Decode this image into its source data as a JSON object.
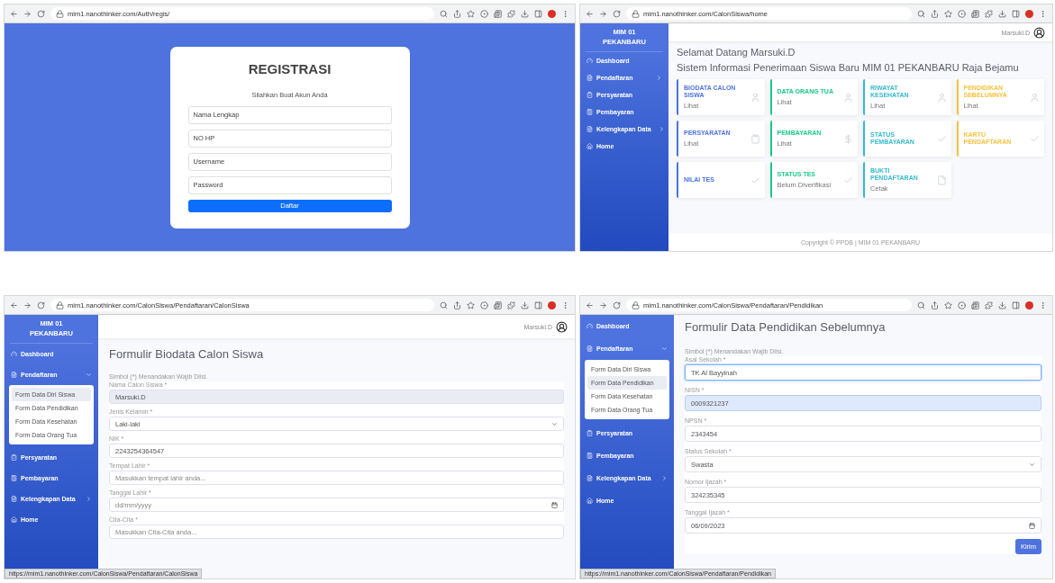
{
  "screens": [
    {
      "kind": "register",
      "url": "mim1.nanothinker.com/Auth/regis/",
      "title": "REGISTRASI",
      "subtitle": "Silahkan Buat Akun Anda",
      "fields": [
        {
          "placeholder": "Nama Lengkap"
        },
        {
          "placeholder": "NO HP"
        },
        {
          "placeholder": "Username"
        },
        {
          "placeholder": "Password"
        }
      ],
      "submit": "Daftar"
    },
    {
      "kind": "dashboard",
      "url": "mim1.nanothinker.com/CalonSiswa/home",
      "brand": "MIM 01 PEKANBARU",
      "user": "Marsuki.D",
      "menu": [
        {
          "kind": "link",
          "label": "Dashboard"
        },
        {
          "kind": "group",
          "label": "Pendaftaran",
          "expanded": false
        },
        {
          "kind": "link",
          "label": "Persyaratan"
        },
        {
          "kind": "link",
          "label": "Pembayaran"
        },
        {
          "kind": "group",
          "label": "Kelengkapan Data",
          "expanded": false
        },
        {
          "kind": "link",
          "label": "Home"
        }
      ],
      "welcome": "Selamat Datang Marsuki.D",
      "headline": "Sistem Informasi Penerimaan Siswa Baru MIM 01 PEKANBARU Raja Bejamu",
      "cards": [
        {
          "title": "BIODATA CALON SISWA",
          "value": "Lihat",
          "color": "#4e73df",
          "kind": "user"
        },
        {
          "title": "DATA ORANG TUA",
          "value": "Lihat",
          "color": "#1cc88a",
          "kind": "user"
        },
        {
          "title": "RIWAYAT KESEHATAN",
          "value": "Lihat",
          "color": "#36b9cc",
          "kind": "user"
        },
        {
          "title": "PENDIDIKAN SEBELUMNYA",
          "value": "Lihat",
          "color": "#f6c23e",
          "kind": "user"
        },
        {
          "title": "PERSYARATAN",
          "value": "Lihat",
          "color": "#4e73df",
          "kind": "clipboard"
        },
        {
          "title": "PEMBAYARAN",
          "value": "Lihat",
          "color": "#1cc88a",
          "kind": "dollar"
        },
        {
          "title": "STATUS PEMBAYARAN",
          "color": "#36b9cc",
          "kind": "check"
        },
        {
          "title": "KARTU PENDAFTARAN",
          "color": "#f6c23e",
          "kind": "check"
        },
        {
          "title": "NILAI TES",
          "color": "#4e73df",
          "kind": "check"
        },
        {
          "title": "STATUS TES",
          "value": "Belum Diverifikasi",
          "color": "#1cc88a",
          "kind": "check"
        },
        {
          "title": "BUKTI PENDAFTARAN",
          "value": "Cetak",
          "color": "#36b9cc",
          "kind": "file"
        }
      ],
      "footer": "Copyright © PPDB | MIM 01 PEKANBARU"
    },
    {
      "kind": "form",
      "url": "mim1.nanothinker.com/CalonSiswa/Pendaftaran/CalonSiswa",
      "brand": "MIM 01 PEKANBARU",
      "user": "Marsuki.D",
      "menu": [
        {
          "kind": "link",
          "label": "Dashboard"
        },
        {
          "kind": "group",
          "label": "Pendaftaran",
          "expanded": true,
          "children": [
            {
              "label": "Form Data Diri Siswa",
              "selected": true
            },
            {
              "label": "Form Data Pendidikan",
              "selected": false
            },
            {
              "label": "Form Data Kesehatan",
              "selected": false
            },
            {
              "label": "Form Data Orang Tua",
              "selected": false
            }
          ]
        },
        {
          "kind": "link",
          "label": "Persyaratan"
        },
        {
          "kind": "link",
          "label": "Pembayaran"
        },
        {
          "kind": "group",
          "label": "Kelengkapan Data",
          "expanded": false
        },
        {
          "kind": "link",
          "label": "Home"
        }
      ],
      "title": "Formulir Biodata Calon Siswa",
      "note": "Simbol (*) Menandakan Wajib Diisi.",
      "fields": [
        {
          "label": "Nama Calon Siswa *",
          "kind": "readonly",
          "value": "Marsuki.D",
          "focused": false,
          "autofilled": false
        },
        {
          "label": "Jenis Kelamin *",
          "kind": "select",
          "value": "Laki-laki",
          "focused": false,
          "autofilled": false
        },
        {
          "label": "NIK *",
          "kind": "text",
          "value": "2243254364547",
          "focused": false,
          "autofilled": false
        },
        {
          "label": "Tempat Lahir *",
          "kind": "text",
          "placeholder": "Masukkan tempat lahir anda...",
          "focused": false,
          "autofilled": false
        },
        {
          "label": "Tanggal Lahir *",
          "kind": "date",
          "placeholder": "dd/mm/yyyy",
          "focused": false,
          "autofilled": false
        },
        {
          "label": "Cita-Cita *",
          "kind": "text",
          "placeholder": "Masukkan Cita-Cita anda...",
          "focused": false,
          "autofilled": false
        }
      ],
      "status_url": "https://mim1.nanothinker.com/CalonSiswa/Pendaftaran/CalonSiswa"
    },
    {
      "kind": "form",
      "url": "mim1.nanothinker.com/CalonSiswa/Pendaftaran/Pendidikan",
      "menu": [
        {
          "kind": "link",
          "label": "Dashboard"
        },
        {
          "kind": "group",
          "label": "Pendaftaran",
          "expanded": true,
          "children": [
            {
              "label": "Form Data Diri Siswa",
              "selected": false
            },
            {
              "label": "Form Data Pendidikan",
              "selected": true
            },
            {
              "label": "Form Data Kesehatan",
              "selected": false
            },
            {
              "label": "Form Data Orang Tua",
              "selected": false
            }
          ]
        },
        {
          "kind": "link",
          "label": "Persyaratan"
        },
        {
          "kind": "link",
          "label": "Pembayaran"
        },
        {
          "kind": "group",
          "label": "Kelengkapan Data",
          "expanded": false
        },
        {
          "kind": "link",
          "label": "Home"
        }
      ],
      "title": "Formulir Data Pendidikan Sebelumnya",
      "note": "Simbol (*) Menandakan Wajib Diisi.",
      "fields": [
        {
          "label": "Asal Sekolah *",
          "kind": "text",
          "value": "TK Al Bayyinah",
          "focused": true,
          "autofilled": false
        },
        {
          "label": "NISN *",
          "kind": "text",
          "value": "0009321237",
          "focused": false,
          "autofilled": true
        },
        {
          "label": "NPSN *",
          "kind": "text",
          "value": "2343454",
          "focused": false,
          "autofilled": false
        },
        {
          "label": "Status Sekolah *",
          "kind": "select",
          "value": "Swasta",
          "focused": false,
          "autofilled": false
        },
        {
          "label": "Nomor Ijazah *",
          "kind": "text",
          "value": "324235345",
          "focused": false,
          "autofilled": false
        },
        {
          "label": "Tanggal Ijazah *",
          "kind": "date",
          "value": "06/09/2023",
          "focused": false,
          "autofilled": false
        }
      ],
      "submit": "Kirim",
      "status_url": "https://mim1.nanothinker.com/CalonSiswa/Pendaftaran/Pendidikan"
    }
  ]
}
